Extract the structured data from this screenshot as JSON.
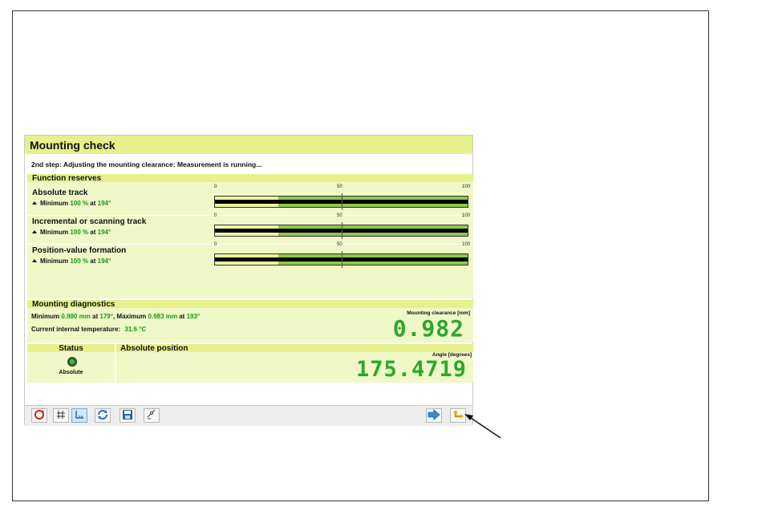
{
  "panel": {
    "title": "Mounting check",
    "step_text": "2nd step: Adjusting the mounting clearance: Measurement is running..."
  },
  "function_reserves": {
    "heading": "Function reserves",
    "scale": [
      "0",
      "50",
      "100"
    ],
    "tracks": [
      {
        "name": "Absolute track",
        "min_prefix": "Minimum",
        "min_value": "100 %",
        "at_text": "at",
        "angle": "194°",
        "good_from_fraction": 0.25
      },
      {
        "name": "Incremental or scanning track",
        "min_prefix": "Minimum",
        "min_value": "100 %",
        "at_text": "at",
        "angle": "194°",
        "good_from_fraction": 0.25
      },
      {
        "name": "Position-value formation",
        "min_prefix": "Minimum",
        "min_value": "100 %",
        "at_text": "at",
        "angle": "194°",
        "good_from_fraction": 0.25
      }
    ]
  },
  "diagnostics": {
    "heading": "Mounting diagnostics",
    "min_label": "Minimum",
    "min_value": "0.980 mm",
    "min_at": "at",
    "min_angle": "179°",
    "max_label": ", Maximum",
    "max_value": "0.983 mm",
    "max_at": "at",
    "max_angle": "193°",
    "temp_label": "Current internal temperature:",
    "temp_value": "31.6 °C",
    "clearance_label": "Mounting clearance [mm]",
    "clearance_value": "0.982"
  },
  "status": {
    "heading": "Status",
    "value": "Absolute",
    "led_color": "#3fbf3f"
  },
  "position": {
    "heading": "Absolute position",
    "angle_label": "Angle [degrees]",
    "angle_value": "175.4719"
  },
  "toolbar": {
    "icons": [
      "refresh-red-icon",
      "grid-icon",
      "axes-icon",
      "sync-icon",
      "save-icon",
      "settings-icon",
      "next-arrow-icon",
      "return-icon"
    ]
  }
}
